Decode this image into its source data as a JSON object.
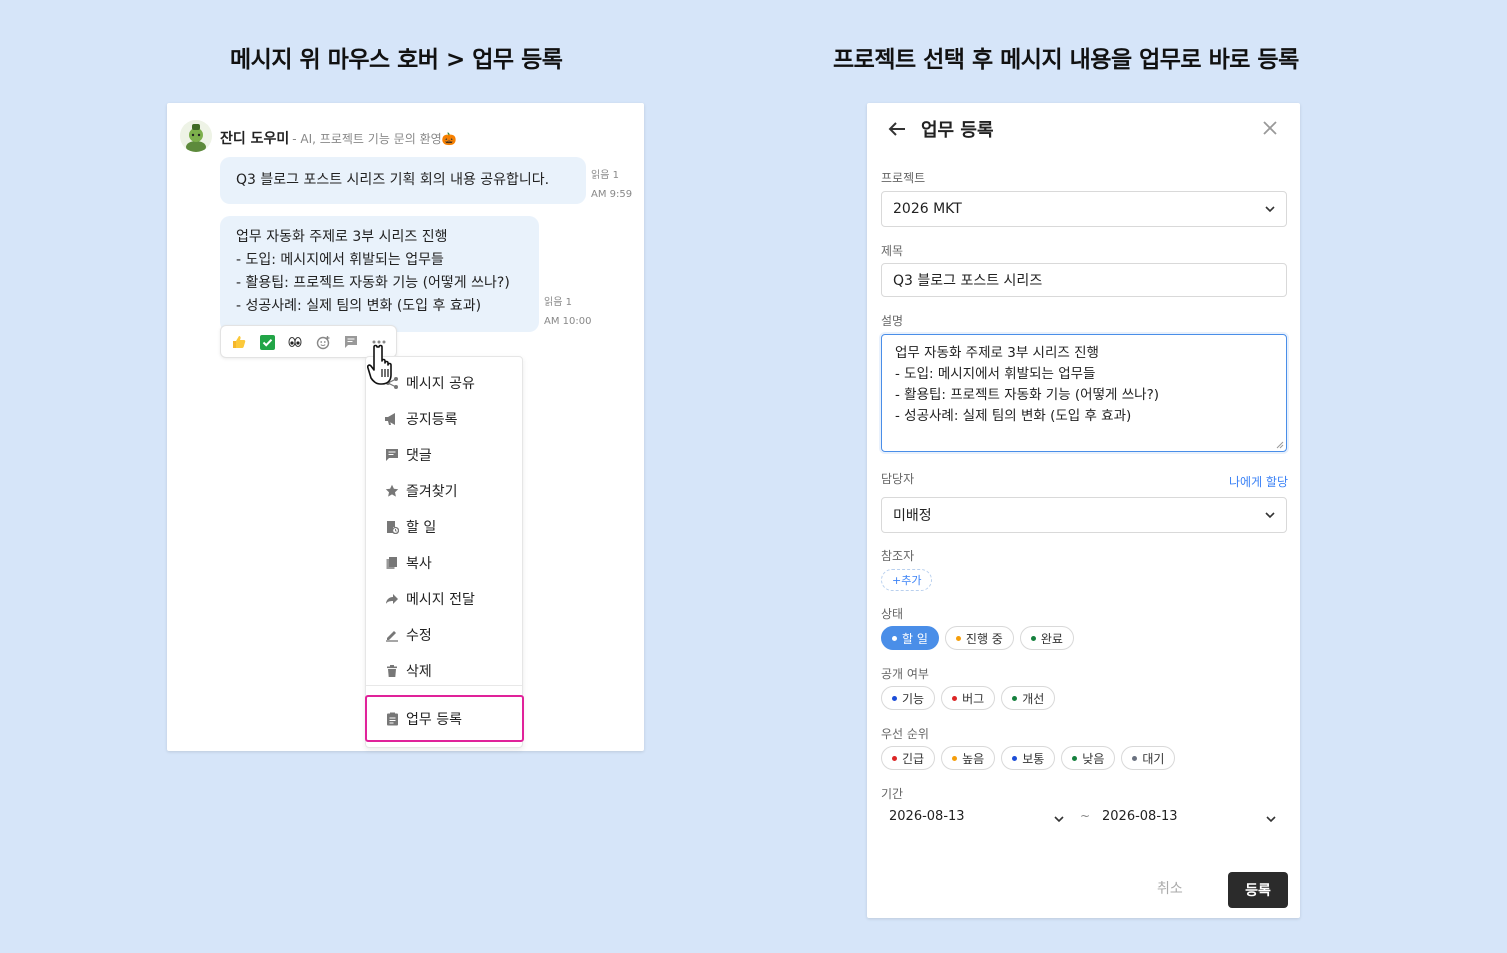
{
  "headings": {
    "left": "메시지 위 마우스 호버 > 업무 등록",
    "right": "프로젝트 선택 후 메시지 내용을 업무로 바로 등록"
  },
  "chat": {
    "sender_name": "잔디 도우미",
    "sender_role": "- AI, 프로젝트 기능 문의 환영🎃",
    "messages": [
      {
        "lines": [
          "Q3 블로그 포스트 시리즈 기획 회의 내용 공유합니다."
        ],
        "read": "읽음 1",
        "time": "AM 9:59"
      },
      {
        "lines": [
          "업무 자동화 주제로 3부 시리즈 진행",
          "- 도입: 메시지에서 휘발되는 업무들",
          "- 활용팁: 프로젝트 자동화 기능 (어떻게 쓰나?)",
          "- 성공사례: 실제 팀의 변화 (도입 후 효과)"
        ],
        "read": "읽음 1",
        "time": "AM 10:00"
      }
    ],
    "reactions": [
      "thumbs-up-icon",
      "check-icon",
      "eyes-icon",
      "add-emoji-icon",
      "comment-icon",
      "more-icon"
    ]
  },
  "context_menu": {
    "items": [
      {
        "label": "메시지 공유",
        "icon": "share-icon"
      },
      {
        "label": "공지등록",
        "icon": "megaphone-icon"
      },
      {
        "label": "댓글",
        "icon": "comment-icon"
      },
      {
        "label": "즐겨찾기",
        "icon": "star-icon"
      },
      {
        "label": "할 일",
        "icon": "todo-icon"
      },
      {
        "label": "복사",
        "icon": "copy-icon"
      },
      {
        "label": "메시지 전달",
        "icon": "forward-icon"
      },
      {
        "label": "수정",
        "icon": "edit-icon"
      },
      {
        "label": "삭제",
        "icon": "trash-icon"
      },
      {
        "label": "업무 등록",
        "icon": "task-icon"
      }
    ],
    "highlight_color": "#e0229a"
  },
  "task_form": {
    "title": "업무 등록",
    "project": {
      "label": "프로젝트",
      "value": "2026 MKT"
    },
    "name": {
      "label": "제목",
      "value": "Q3 블로그 포스트 시리즈"
    },
    "description": {
      "label": "설명",
      "lines": [
        "업무 자동화 주제로 3부 시리즈 진행",
        "- 도입: 메시지에서 휘발되는 업무들",
        "- 활용팁: 프로젝트 자동화 기능 (어떻게 쓰나?)",
        "- 성공사례: 실제 팀의 변화 (도입 후 효과)"
      ]
    },
    "assignee": {
      "label": "담당자",
      "value": "미배정",
      "assign_me": "나에게 할당"
    },
    "participants": {
      "label": "참조자",
      "add": "+추가"
    },
    "status": {
      "label": "상태",
      "options": [
        {
          "label": "할 일",
          "color": "#ffffff",
          "active": true
        },
        {
          "label": "진행 중",
          "color": "#f59e0b",
          "active": false
        },
        {
          "label": "완료",
          "color": "#15803d",
          "active": false
        }
      ]
    },
    "visibility": {
      "label": "공개 여부",
      "options": [
        {
          "label": "기능",
          "color": "#1d4ed8"
        },
        {
          "label": "버그",
          "color": "#dc2626"
        },
        {
          "label": "개선",
          "color": "#15803d"
        }
      ]
    },
    "priority": {
      "label": "우선 순위",
      "options": [
        {
          "label": "긴급",
          "color": "#dc2626"
        },
        {
          "label": "높음",
          "color": "#f59e0b"
        },
        {
          "label": "보통",
          "color": "#1d4ed8"
        },
        {
          "label": "낮음",
          "color": "#15803d"
        },
        {
          "label": "대기",
          "color": "#6b7280"
        }
      ]
    },
    "period": {
      "label": "기간",
      "start": "2026-08-13",
      "end": "2026-08-13",
      "separator": "~"
    },
    "cancel": "취소",
    "submit": "등록",
    "accent_color": "#4a8ee8"
  }
}
